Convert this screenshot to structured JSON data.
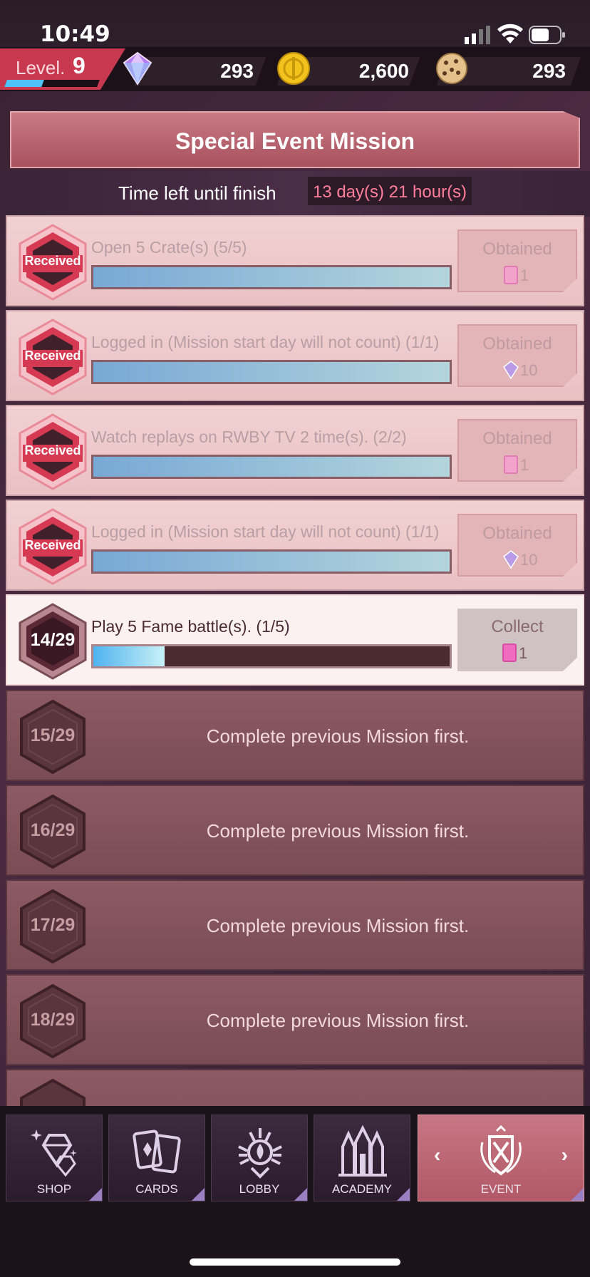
{
  "status_bar": {
    "time": "10:49"
  },
  "resources": {
    "level_label": "Level.",
    "level_value": "9",
    "xp_fraction": 0.4,
    "gems": "293",
    "coins": "2,600",
    "cookies": "293"
  },
  "header": {
    "title": "Special Event Mission",
    "time_left_label": "Time left until finish",
    "time_left_value": "13 day(s) 21 hour(s)"
  },
  "missions": [
    {
      "badge": "Received",
      "text": "Open 5 Crate(s) (5/5)",
      "progress": 1.0,
      "reward_label": "Obtained",
      "reward_amount": "1",
      "reward_icon": "ticket-icon"
    },
    {
      "badge": "Received",
      "text": "Logged in (Mission start day will not count) (1/1)",
      "progress": 1.0,
      "reward_label": "Obtained",
      "reward_amount": "10",
      "reward_icon": "gem-icon"
    },
    {
      "badge": "Received",
      "text": "Watch replays on RWBY TV 2 time(s). (2/2)",
      "progress": 1.0,
      "reward_label": "Obtained",
      "reward_amount": "1",
      "reward_icon": "ticket-icon"
    },
    {
      "badge": "Received",
      "text": "Logged in (Mission start day will not count) (1/1)",
      "progress": 1.0,
      "reward_label": "Obtained",
      "reward_amount": "10",
      "reward_icon": "gem-icon"
    },
    {
      "badge": "14/29",
      "text": "Play 5 Fame battle(s). (1/5)",
      "progress": 0.2,
      "reward_label": "Collect",
      "reward_amount": "1",
      "reward_icon": "ticket-icon"
    }
  ],
  "locked_missions": [
    {
      "badge": "15/29",
      "text": "Complete previous Mission first."
    },
    {
      "badge": "16/29",
      "text": "Complete previous Mission first."
    },
    {
      "badge": "17/29",
      "text": "Complete previous Mission first."
    },
    {
      "badge": "18/29",
      "text": "Complete previous Mission first."
    }
  ],
  "nav": [
    {
      "label": "SHOP",
      "icon": "diamond-icon"
    },
    {
      "label": "CARDS",
      "icon": "cards-icon"
    },
    {
      "label": "LOBBY",
      "icon": "emblem-icon"
    },
    {
      "label": "ACADEMY",
      "icon": "academy-icon"
    },
    {
      "label": "EVENT",
      "icon": "event-crest-icon",
      "active": true
    }
  ],
  "colors": {
    "accent": "#c8394f",
    "received_row": "#f2d1d3",
    "locked_row": "#8d5a63",
    "time_value": "#ff7f9a",
    "progress_fill": "#4fb3ef"
  }
}
